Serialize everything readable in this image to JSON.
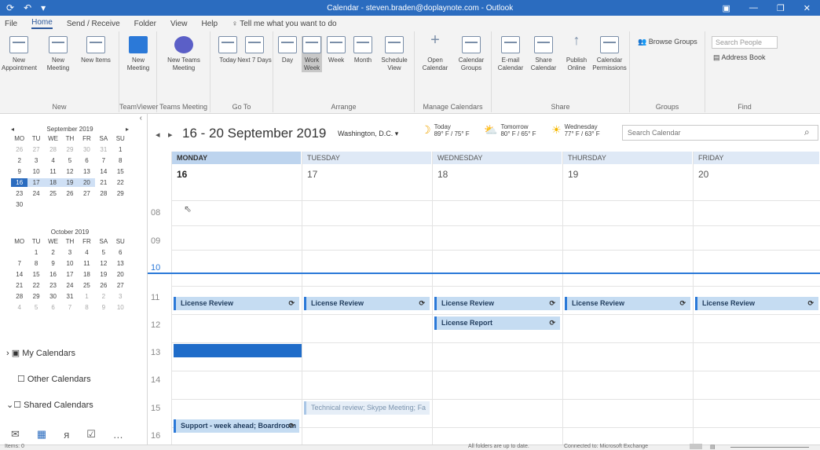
{
  "window": {
    "title": "Calendar - steven.braden@doplaynote.com - Outlook"
  },
  "menu": [
    "File",
    "Home",
    "Send / Receive",
    "Folder",
    "View",
    "Help"
  ],
  "tell_me": "Tell me what you want to do",
  "ribbon": {
    "new_appointment": "New Appointment",
    "new_meeting": "New Meeting",
    "new_items": "New Items",
    "new_group": "New",
    "tv_meeting": "New Meeting",
    "tv_group": "TeamViewer",
    "teams_meeting": "New Teams Meeting",
    "teams_group": "Teams Meeting",
    "today": "Today",
    "next7": "Next 7 Days",
    "goto_group": "Go To",
    "day": "Day",
    "workweek": "Work Week",
    "week": "Week",
    "month": "Month",
    "schedule": "Schedule View",
    "arrange_group": "Arrange",
    "open_cal": "Open Calendar",
    "cal_groups": "Calendar Groups",
    "manage_group": "Manage Calendars",
    "email_cal": "E-mail Calendar",
    "share_cal": "Share Calendar",
    "publish": "Publish Online",
    "cal_perm": "Calendar Permissions",
    "share_group": "Share",
    "browse_groups": "Browse Groups",
    "groups_group": "Groups",
    "search_people": "Search People",
    "address_book": "Address Book",
    "find_group": "Find"
  },
  "mini1": {
    "title": "September 2019",
    "days": [
      "MO",
      "TU",
      "WE",
      "TH",
      "FR",
      "SA",
      "SU"
    ],
    "dates": [
      "26",
      "27",
      "28",
      "29",
      "30",
      "31",
      "1",
      "2",
      "3",
      "4",
      "5",
      "6",
      "7",
      "8",
      "9",
      "10",
      "11",
      "12",
      "13",
      "14",
      "15",
      "16",
      "17",
      "18",
      "19",
      "20",
      "21",
      "22",
      "23",
      "24",
      "25",
      "26",
      "27",
      "28",
      "29",
      "30"
    ]
  },
  "mini2": {
    "title": "October 2019",
    "days": [
      "MO",
      "TU",
      "WE",
      "TH",
      "FR",
      "SA",
      "SU"
    ],
    "dates": [
      "",
      "1",
      "2",
      "3",
      "4",
      "5",
      "6",
      "7",
      "8",
      "9",
      "10",
      "11",
      "12",
      "13",
      "14",
      "15",
      "16",
      "17",
      "18",
      "19",
      "20",
      "21",
      "22",
      "23",
      "24",
      "25",
      "26",
      "27",
      "28",
      "29",
      "30",
      "31",
      "1",
      "2",
      "3",
      "4",
      "5",
      "6",
      "7",
      "8",
      "9",
      "10"
    ]
  },
  "nav": {
    "my": "My Calendars",
    "other": "Other Calendars",
    "shared": "Shared Calendars"
  },
  "calendar": {
    "range": "16 - 20 September 2019",
    "location": "Washington, D.C.",
    "w1": {
      "label": "Today",
      "temp": "89° F / 75° F"
    },
    "w2": {
      "label": "Tomorrow",
      "temp": "80° F / 65° F"
    },
    "w3": {
      "label": "Wednesday",
      "temp": "77° F / 63° F"
    },
    "search_placeholder": "Search Calendar",
    "days": [
      {
        "name": "MONDAY",
        "num": "16"
      },
      {
        "name": "TUESDAY",
        "num": "17"
      },
      {
        "name": "WEDNESDAY",
        "num": "18"
      },
      {
        "name": "THURSDAY",
        "num": "19"
      },
      {
        "name": "FRIDAY",
        "num": "20"
      }
    ],
    "hours": [
      "08",
      "09",
      "10",
      "11",
      "12",
      "13",
      "14",
      "15",
      "16"
    ],
    "events": {
      "review": "License Review",
      "report": "License Report",
      "tech": "Technical review; Skype Meeting; Fa",
      "support": "Support - week ahead; Boardroom"
    }
  },
  "status": {
    "items": "Items: 0",
    "sync": "All folders are up to date.",
    "conn": "Connected to: Microsoft Exchange"
  },
  "colors": {
    "accent": "#2b6cbf",
    "event": "#c5dcf2",
    "event_border": "#2b79d8"
  }
}
